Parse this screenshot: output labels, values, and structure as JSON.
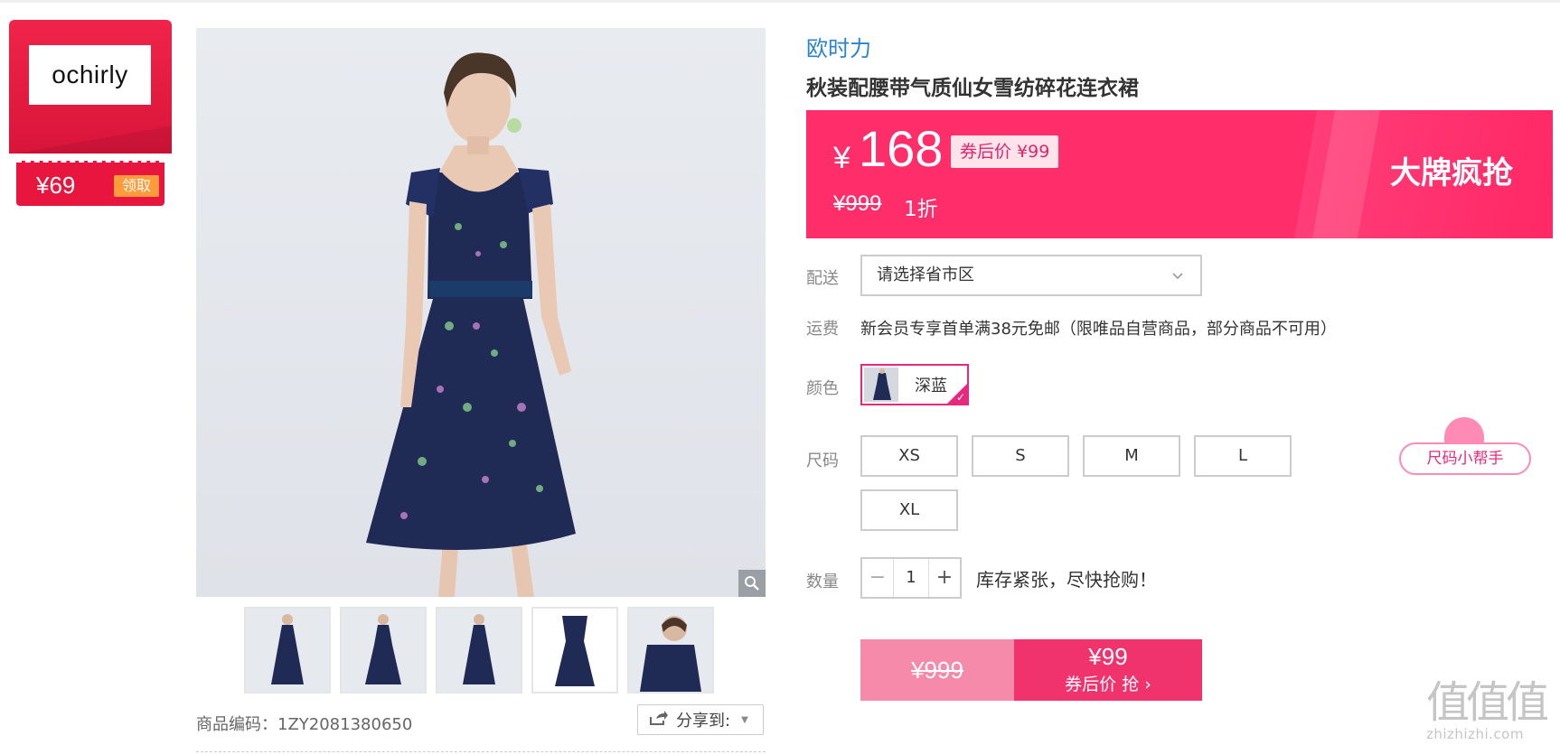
{
  "coupon": {
    "brand_logo": "ochirly",
    "amount": "¥69",
    "claim_label": "领取"
  },
  "gallery": {
    "main_image": "navy-floral-chiffon-dress-photo",
    "thumb_count": 5,
    "product_code": "商品编码：1ZY2081380650",
    "share_label": "分享到:"
  },
  "product": {
    "brand": "欧时力",
    "title": "秋装配腰带气质仙女雪纺碎花连衣裙",
    "price_symbol": "¥",
    "price": "168",
    "coupon_price": "券后价 ¥99",
    "original_price": "¥999",
    "discount": "1折",
    "promo_label": "大牌疯抢"
  },
  "delivery": {
    "label": "配送",
    "placeholder": "请选择省市区"
  },
  "shipping": {
    "label": "运费",
    "text": "新会员专享首单满38元免邮（限唯品自营商品，部分商品不可用）"
  },
  "color": {
    "label": "颜色",
    "selected": "深蓝"
  },
  "size": {
    "label": "尺码",
    "options": [
      "XS",
      "S",
      "M",
      "L",
      "XL"
    ],
    "helper": "尺码小帮手"
  },
  "quantity": {
    "label": "数量",
    "minus": "−",
    "value": "1",
    "plus": "+",
    "stock_note": "库存紧张，尽快抢购！"
  },
  "buy": {
    "original": "¥999",
    "price": "¥99",
    "action": "券后价 抢 ›"
  },
  "watermark": {
    "glyphs": "值值值",
    "url": "zhizhizhi.com"
  },
  "colors": {
    "accent": "#ff2d6a",
    "brand_blue": "#2a83d0",
    "coupon_red": "#e8153e",
    "select_pink": "#e7287d"
  }
}
